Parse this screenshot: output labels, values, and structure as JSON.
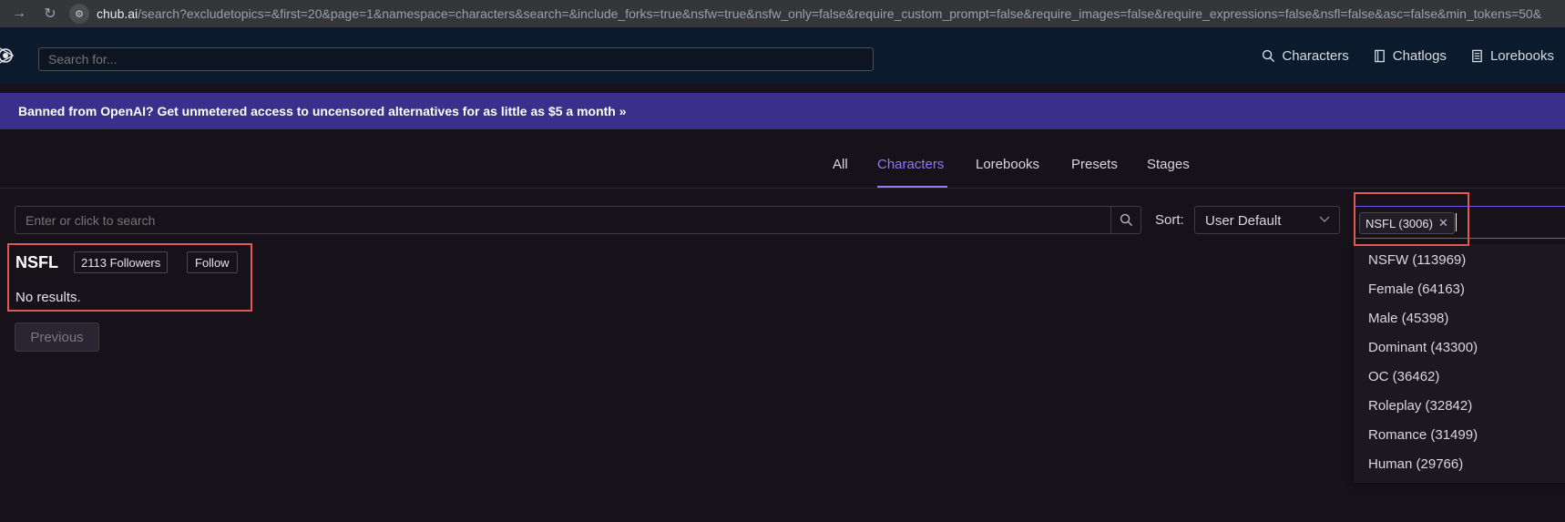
{
  "browser": {
    "url_host": "chub.ai",
    "url_path": "/search?excludetopics=&first=20&page=1&namespace=characters&search=&include_forks=true&nsfw=true&nsfw_only=false&require_custom_prompt=false&require_images=false&require_expressions=false&nsfl=false&asc=false&min_tokens=50&"
  },
  "header": {
    "search_placeholder": "Search for...",
    "nav": [
      {
        "label": "Characters",
        "icon": "search-icon"
      },
      {
        "label": "Chatlogs",
        "icon": "book-icon"
      },
      {
        "label": "Lorebooks",
        "icon": "list-icon"
      }
    ]
  },
  "banner": {
    "text": "Banned from OpenAI? Get unmetered access to uncensored alternatives for as little as $5 a month »"
  },
  "tabs": [
    {
      "label": "All",
      "active": false
    },
    {
      "label": "Characters",
      "active": true
    },
    {
      "label": "Lorebooks",
      "active": false
    },
    {
      "label": "Presets",
      "active": false
    },
    {
      "label": "Stages",
      "active": false
    }
  ],
  "search": {
    "placeholder": "Enter or click to search"
  },
  "sort": {
    "label": "Sort:",
    "value": "User Default"
  },
  "tag_filter": {
    "selected": "NSFL (3006)",
    "options": [
      "NSFW (113969)",
      "Female (64163)",
      "Male (45398)",
      "Dominant (43300)",
      "OC (36462)",
      "Roleplay (32842)",
      "Romance (31499)",
      "Human (29766)"
    ]
  },
  "topic": {
    "title": "NSFL",
    "followers": "2113 Followers",
    "follow_label": "Follow",
    "empty_text": "No results."
  },
  "pagination": {
    "previous_label": "Previous"
  },
  "colors": {
    "accent": "#8b7cf4",
    "banner": "#3b2f8c",
    "header": "#0c1a2e",
    "background": "#17121a",
    "highlight": "#e0584e"
  }
}
